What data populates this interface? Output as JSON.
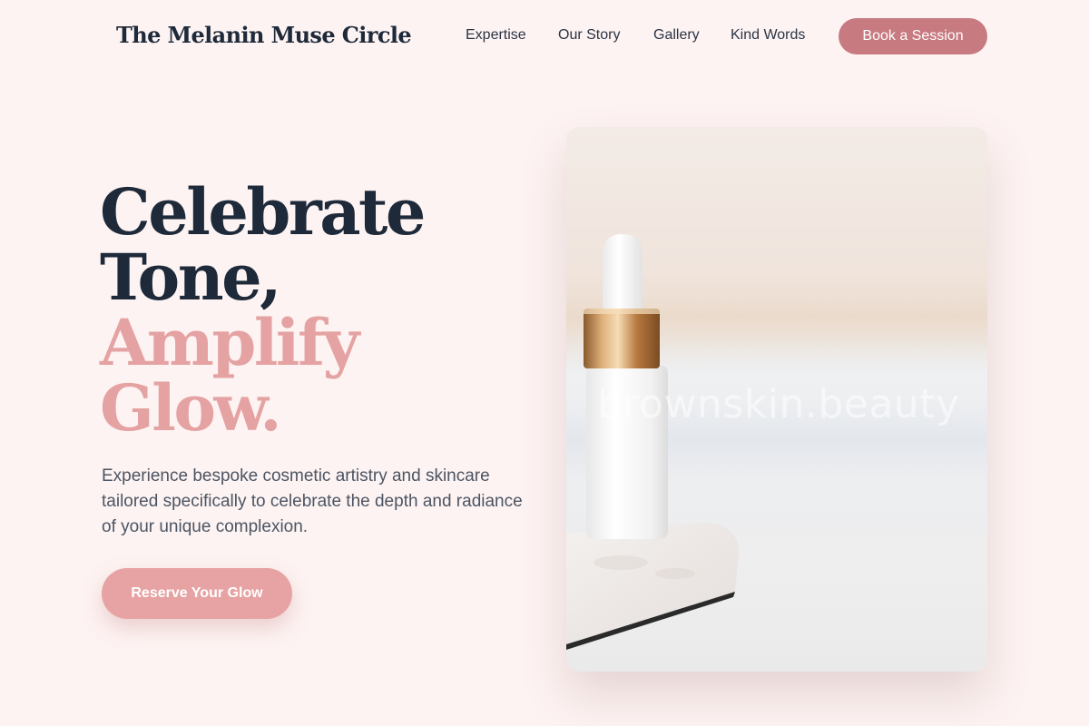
{
  "brand": {
    "name": "The Melanin Muse Circle"
  },
  "nav": {
    "items": [
      {
        "label": "Expertise"
      },
      {
        "label": "Our Story"
      },
      {
        "label": "Gallery"
      },
      {
        "label": "Kind Words"
      }
    ],
    "cta_label": "Book a Session"
  },
  "hero": {
    "headline_line1": "Celebrate",
    "headline_line2": "Tone,",
    "headline_line3": "Amplify",
    "headline_line4": "Glow.",
    "description": "Experience bespoke cosmetic artistry and skincare tailored specifically to celebrate the depth and radiance of your unique complexion.",
    "cta_label": "Reserve Your Glow",
    "image_watermark": "brownskin.beauty"
  },
  "colors": {
    "page_background": "#fdf3f2",
    "text_dark": "#1e2a3a",
    "accent_pink": "#e5a2a2",
    "button_rose": "#c77a80",
    "button_pink": "#e7a3a3"
  }
}
